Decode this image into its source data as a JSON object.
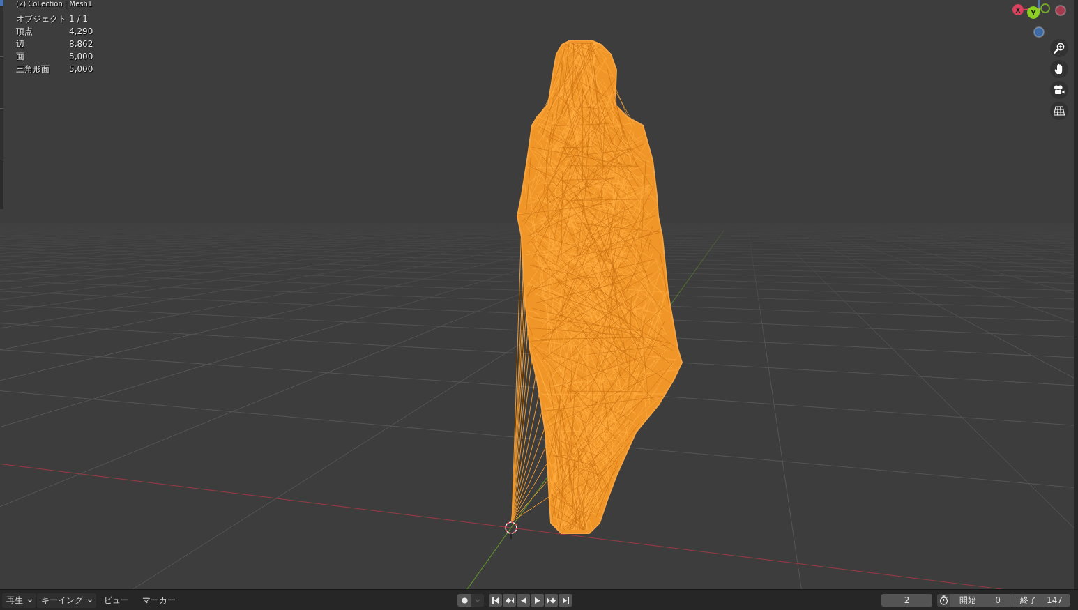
{
  "viewport": {
    "breadcrumb": "(2) Collection | Mesh1",
    "stats": [
      {
        "label": "オブジェクト",
        "value": "1 / 1"
      },
      {
        "label": "頂点",
        "value": "4,290"
      },
      {
        "label": "辺",
        "value": "8,862"
      },
      {
        "label": "面",
        "value": "5,000"
      },
      {
        "label": "三角形面",
        "value": "5,000"
      }
    ]
  },
  "axis_gizmo": {
    "axes": [
      {
        "kind": "labeled",
        "label": "X",
        "color": "#d9415c"
      },
      {
        "kind": "labeled",
        "label": "Y",
        "color": "#8ccf22"
      },
      {
        "kind": "ring",
        "color": "#74a72c"
      },
      {
        "kind": "dot",
        "color": "#a33a4d"
      },
      {
        "kind": "dot",
        "color": "#3e6aa6"
      }
    ]
  },
  "timeline": {
    "menus": [
      {
        "kind": "dropdown",
        "label": "再生"
      },
      {
        "kind": "dropdown",
        "label": "キーイング"
      },
      {
        "kind": "menu",
        "label": "ビュー"
      },
      {
        "kind": "menu",
        "label": "マーカー"
      }
    ],
    "auto_keying": {
      "on": false
    },
    "auto_keying_options": {
      "disabled": true
    },
    "current_frame": "2",
    "frame_range": [
      {
        "label": "開始",
        "value": "0"
      },
      {
        "label": "終了",
        "value": "147"
      }
    ]
  }
}
